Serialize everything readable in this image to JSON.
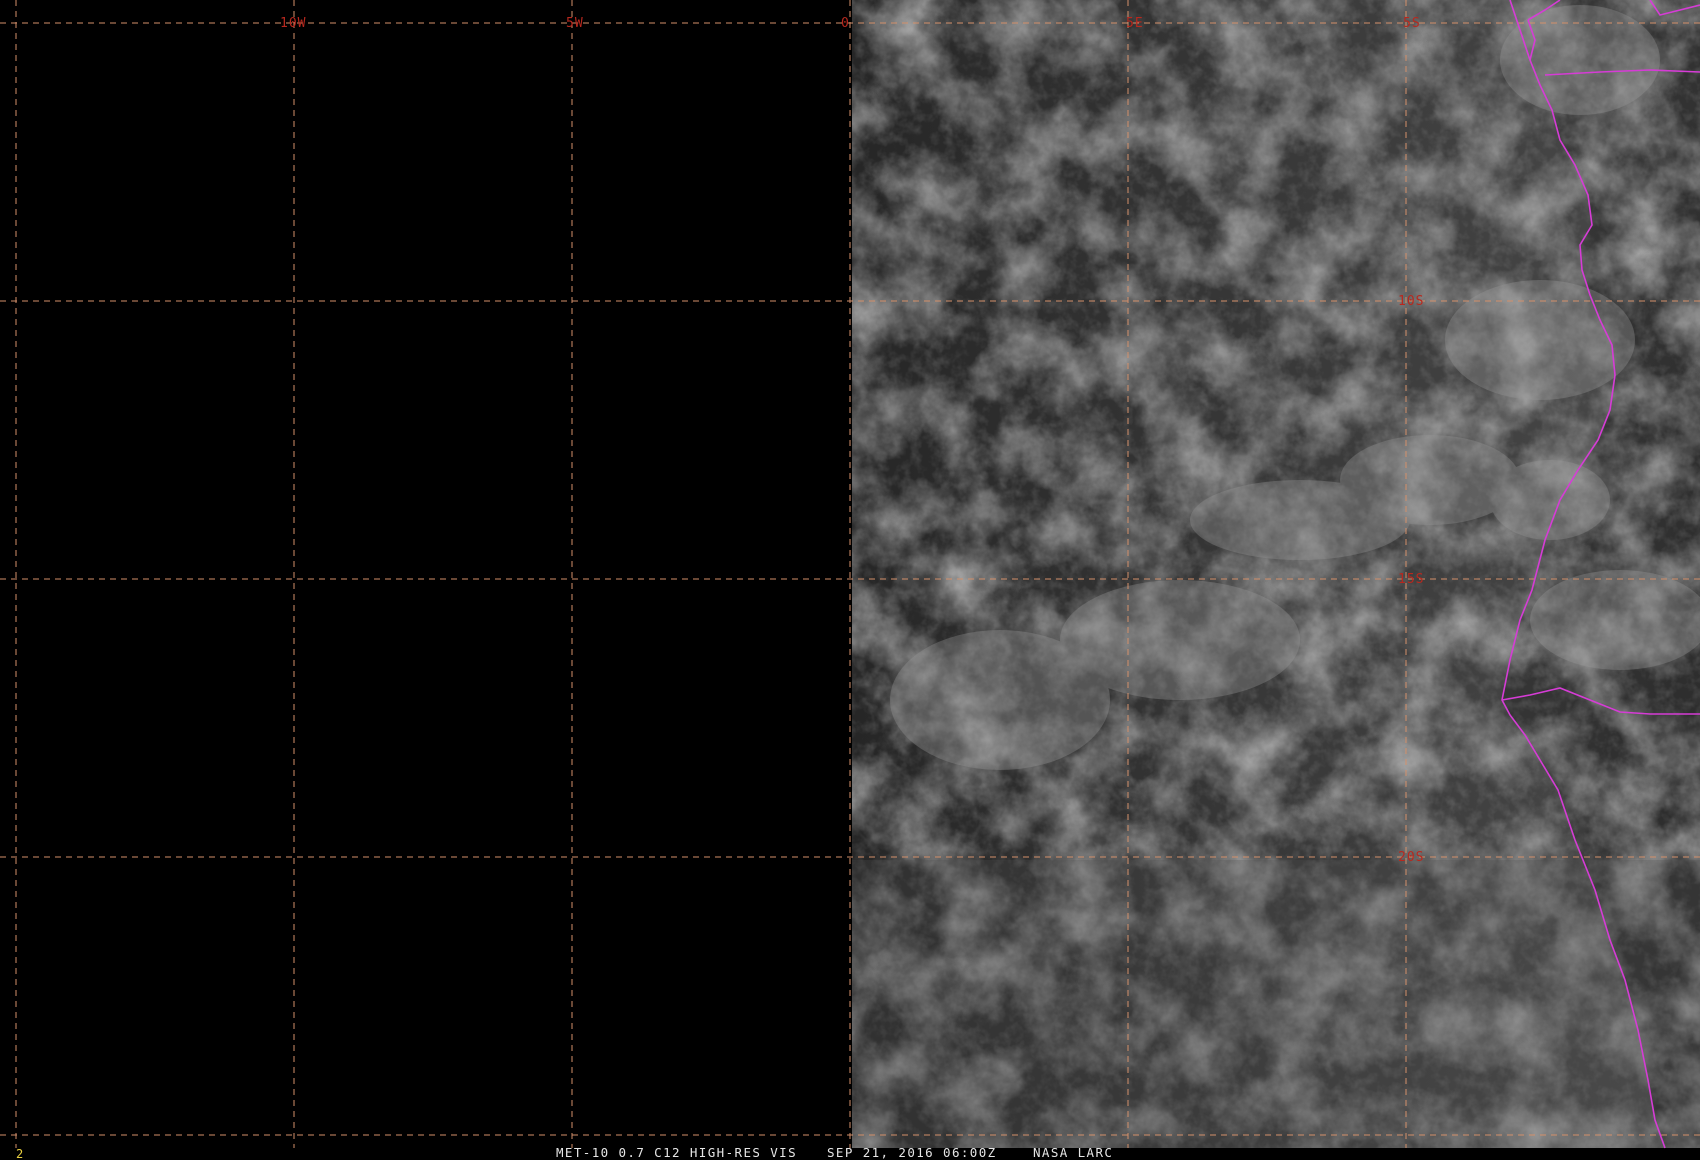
{
  "frame": {
    "number": "2"
  },
  "caption": {
    "product": "MET-10 0.7 C12 HIGH-RES VIS",
    "datetime": "SEP 21, 2016 06:00Z",
    "credit": "NASA LARC"
  },
  "grid": {
    "longitude_labels": [
      "10W",
      "5W",
      "0",
      "5E",
      "5S"
    ],
    "latitude_labels": [
      "10S",
      "15S",
      "20S"
    ]
  },
  "colors": {
    "grid_line": "#d4906a",
    "grid_label": "#b8281e",
    "political_border": "#d63cd6",
    "caption_text": "#e6e6e6",
    "frame_number": "#e8d040",
    "background": "#000000"
  }
}
